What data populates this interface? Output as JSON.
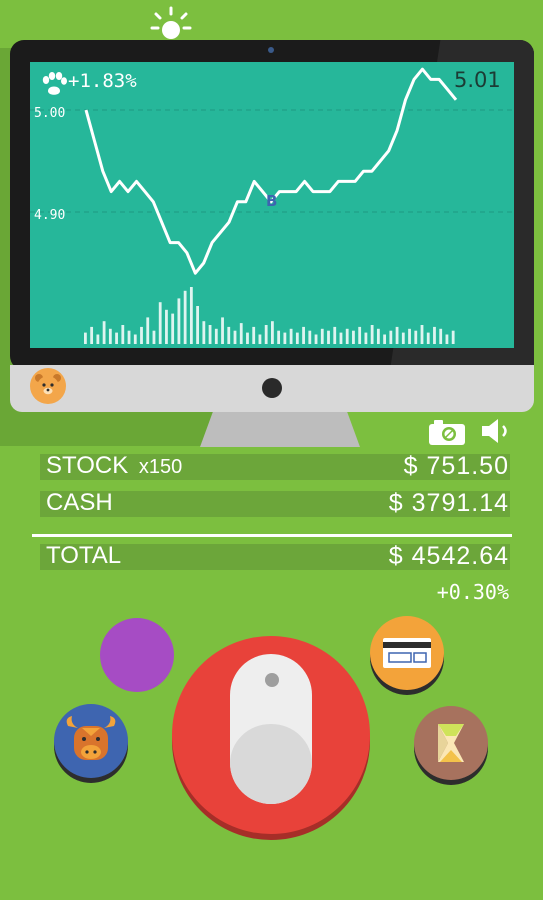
{
  "chart": {
    "change": "+1.83%",
    "price": "5.01",
    "ticks": [
      "5.00",
      "4.90"
    ],
    "marker": "B",
    "line_color": "#ffffff",
    "volume_color": "#ffffff",
    "chart_data": {
      "type": "line",
      "y_axis": {
        "ticks": [
          5.0,
          4.9
        ]
      },
      "series": [
        {
          "values": [
            5.0,
            4.97,
            4.94,
            4.92,
            4.93,
            4.92,
            4.93,
            4.92,
            4.91,
            4.89,
            4.87,
            4.87,
            4.86,
            4.84,
            4.85,
            4.87,
            4.88,
            4.89,
            4.91,
            4.91,
            4.93,
            4.92,
            4.91,
            4.92,
            4.92,
            4.92,
            4.93,
            4.92,
            4.92,
            4.92,
            4.93,
            4.93,
            4.93,
            4.94,
            4.94,
            4.95,
            4.96,
            4.98,
            5.01,
            5.03,
            5.04,
            5.03,
            5.03,
            5.02,
            5.01
          ]
        }
      ],
      "volume": [
        6,
        9,
        5,
        12,
        8,
        6,
        10,
        7,
        5,
        9,
        14,
        7,
        22,
        18,
        16,
        24,
        28,
        30,
        20,
        12,
        10,
        8,
        14,
        9,
        7,
        11,
        6,
        9,
        5,
        10,
        12,
        7,
        6,
        8,
        6,
        9,
        7,
        5,
        8,
        7,
        9,
        6,
        8,
        7,
        9,
        6,
        10,
        8,
        5,
        7,
        9,
        6,
        8,
        7,
        10,
        6,
        9,
        8,
        5,
        7
      ]
    }
  },
  "icons": {
    "paw": "paw-icon",
    "sun": "sun-icon",
    "bear": "bear-icon",
    "camera": "camera-icon",
    "speaker": "speaker-icon",
    "card": "credit-card-icon",
    "bull": "bull-icon",
    "hourglass": "hourglass-icon",
    "mouse": "mouse-icon"
  },
  "stats": {
    "stock_label": "STOCK",
    "stock_qty": "x150",
    "stock_value": "$ 751.50",
    "cash_label": "CASH",
    "cash_value": "$ 3791.14",
    "total_label": "TOTAL",
    "total_value": "$ 4542.64",
    "total_change": "+0.30%"
  },
  "colors": {
    "background": "#7cbf3f",
    "screen": "#26b79a",
    "big_button": "#e8423a",
    "purple_button": "#a64cc4",
    "card_button": "#f3a33a",
    "bull_button": "#3e65b0",
    "hourglass_button": "#a7725e"
  }
}
